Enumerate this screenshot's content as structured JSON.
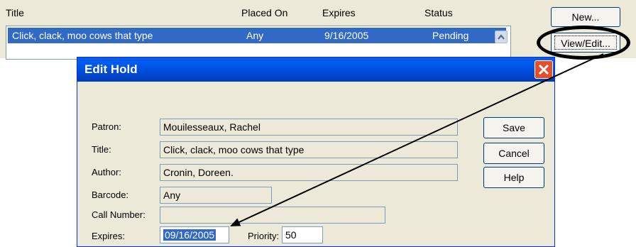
{
  "list": {
    "columns": {
      "title": "Title",
      "placed_on": "Placed On",
      "expires": "Expires",
      "status": "Status"
    },
    "selected_row": {
      "title": "Click, clack, moo cows that type",
      "placed_on": "Any",
      "expires": "9/16/2005",
      "status": "Pending"
    },
    "buttons": {
      "new": "New...",
      "view_edit": "View/Edit..."
    }
  },
  "dialog": {
    "title": "Edit Hold",
    "labels": {
      "patron": "Patron:",
      "title": "Title:",
      "author": "Author:",
      "barcode": "Barcode:",
      "call_number": "Call Number:",
      "expires": "Expires:",
      "priority": "Priority:"
    },
    "values": {
      "patron": "Mouilesseaux, Rachel",
      "title": "Click, clack, moo cows that type",
      "author": "Cronin, Doreen.",
      "barcode": "Any",
      "call_number": "",
      "expires": "09/16/2005",
      "priority": "50"
    },
    "buttons": {
      "save": "Save",
      "cancel": "Cancel",
      "help": "Help"
    }
  },
  "colors": {
    "selection": "#3169c6",
    "titlebar": "#0058ee",
    "close": "#e0502a",
    "window_bg": "#ece9d8"
  },
  "icons": [
    "scroll-up-icon",
    "close-icon"
  ]
}
